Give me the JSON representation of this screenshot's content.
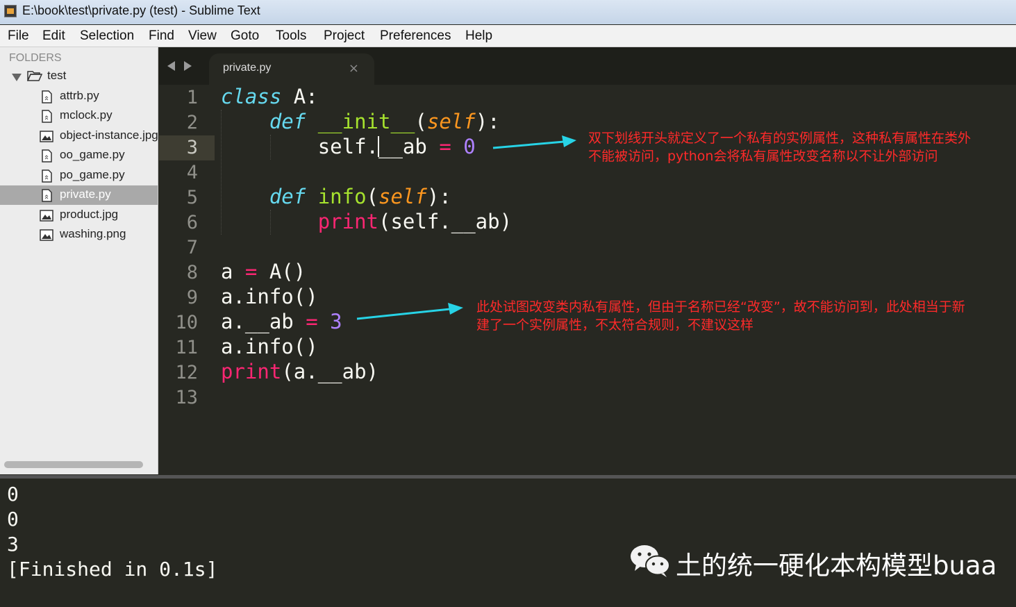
{
  "window": {
    "title": "E:\\book\\test\\private.py (test) - Sublime Text"
  },
  "menu": [
    "File",
    "Edit",
    "Selection",
    "Find",
    "View",
    "Goto",
    "Tools",
    "Project",
    "Preferences",
    "Help"
  ],
  "sidebar": {
    "header": "FOLDERS",
    "folder": "test",
    "files": [
      "attrb.py",
      "mclock.py",
      "object-instance.jpg",
      "oo_game.py",
      "po_game.py",
      "private.py",
      "product.jpg",
      "washing.png"
    ],
    "selected": "private.py"
  },
  "tab": {
    "label": "private.py",
    "close": "×"
  },
  "editor": {
    "line_numbers": [
      "1",
      "2",
      "3",
      "4",
      "5",
      "6",
      "7",
      "8",
      "9",
      "10",
      "11",
      "12",
      "13"
    ],
    "current_line": 3,
    "code": {
      "l1_kw": "class",
      "l1_rest": " A:",
      "l2_indent": "    ",
      "l2_kw": "def",
      "l2_fn": "__init__",
      "l2_open": "(",
      "l2_param": "self",
      "l2_close": "):",
      "l3_indent": "        ",
      "l3_a": "self.",
      "l3_b": "__ab",
      "l3_op": "=",
      "l3_num": "0",
      "l5_indent": "    ",
      "l5_kw": "def",
      "l5_fn": "info",
      "l5_open": "(",
      "l5_param": "self",
      "l5_close": "):",
      "l6_indent": "        ",
      "l6_builtin": "print",
      "l6_rest": "(self.__ab)",
      "l8_a": "a ",
      "l8_op": "=",
      "l8_rest": " A()",
      "l9": "a.info()",
      "l10_a": "a.__ab ",
      "l10_op": "=",
      "l10_num": "3",
      "l11": "a.info()",
      "l12_builtin": "print",
      "l12_rest": "(a.__ab)"
    }
  },
  "annotations": {
    "a1_line1": "双下划线开头就定义了一个私有的实例属性，这种私有属性在类外",
    "a1_line2": "不能被访问，python会将私有属性改变名称以不让外部访问",
    "a2_line1": "此处试图改变类内私有属性，但由于名称已经“改变”，故不能访问到，此处相当于新",
    "a2_line2": "建了一个实例属性，不太符合规则，不建议这样"
  },
  "output": {
    "lines": [
      "0",
      "0",
      "3",
      "[Finished in 0.1s]"
    ]
  },
  "watermark": {
    "text": "土的统一硬化本构模型buaa",
    "icon": "wechat-icon"
  },
  "colors": {
    "arrow": "#27d3e6",
    "annotation": "#ff2a2a",
    "editor_bg": "#272822"
  }
}
